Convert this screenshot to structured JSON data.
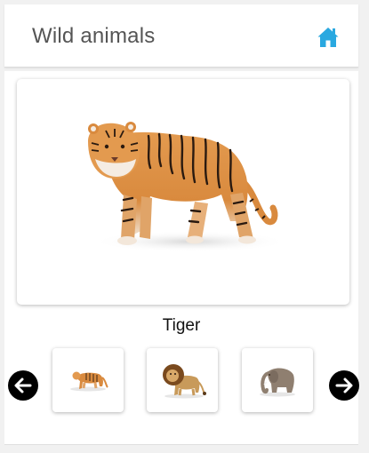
{
  "header": {
    "title": "Wild animals",
    "home_icon": "home-icon",
    "accent_color": "#29a8e0"
  },
  "gallery": {
    "selected": {
      "name": "Tiger",
      "image_icon": "tiger-figure-image"
    },
    "prev_icon": "arrow-left-icon",
    "next_icon": "arrow-right-icon",
    "thumbnails": [
      {
        "icon": "tiger-thumbnail"
      },
      {
        "icon": "lion-thumbnail"
      },
      {
        "icon": "elephant-thumbnail"
      }
    ]
  }
}
